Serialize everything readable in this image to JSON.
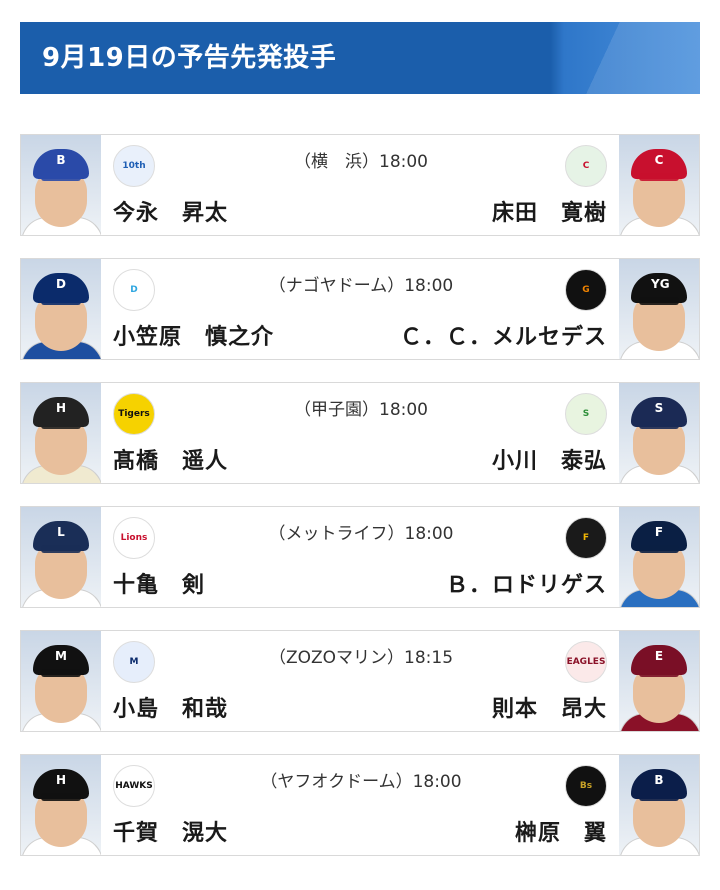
{
  "header": {
    "title": "9月19日の予告先発投手"
  },
  "games": [
    {
      "venue_time": "（横　浜）18:00",
      "home": {
        "pitcher": "今永　昇太",
        "logo_icon": "baystars-logo-icon",
        "logo_text": "10th",
        "cap_mark": "B",
        "cap_color": "#2a4aa8",
        "logo_bg": "#e9f0fb",
        "logo_fg": "#1f5fb5",
        "uniform_color": "#ffffff"
      },
      "away": {
        "pitcher": "床田　寛樹",
        "logo_icon": "carp-logo-icon",
        "logo_text": "C",
        "cap_mark": "C",
        "cap_color": "#c8102e",
        "logo_bg": "#e6f3e6",
        "logo_fg": "#c8102e",
        "uniform_color": "#ffffff"
      }
    },
    {
      "venue_time": "（ナゴヤドーム）18:00",
      "home": {
        "pitcher": "小笠原　慎之介",
        "logo_icon": "dragons-logo-icon",
        "logo_text": "D",
        "cap_mark": "D",
        "cap_color": "#0b2b6b",
        "logo_bg": "#ffffff",
        "logo_fg": "#2ea6e0",
        "uniform_color": "#1e4fa0"
      },
      "away": {
        "pitcher": "Ｃ．Ｃ．メルセデス",
        "logo_icon": "giants-logo-icon",
        "logo_text": "G",
        "cap_mark": "YG",
        "cap_color": "#111111",
        "logo_bg": "#111111",
        "logo_fg": "#f08300",
        "uniform_color": "#ffffff"
      }
    },
    {
      "venue_time": "（甲子園）18:00",
      "home": {
        "pitcher": "髙橋　遥人",
        "logo_icon": "tigers-logo-icon",
        "logo_text": "Tigers",
        "cap_mark": "H",
        "cap_color": "#222222",
        "logo_bg": "#f6d200",
        "logo_fg": "#111111",
        "uniform_color": "#f0ead0"
      },
      "away": {
        "pitcher": "小川　泰弘",
        "logo_icon": "swallows-logo-icon",
        "logo_text": "S",
        "cap_mark": "S",
        "cap_color": "#1b2a55",
        "logo_bg": "#e8f4e0",
        "logo_fg": "#2f8f3a",
        "uniform_color": "#ffffff"
      }
    },
    {
      "venue_time": "（メットライフ）18:00",
      "home": {
        "pitcher": "十亀　剣",
        "logo_icon": "lions-logo-icon",
        "logo_text": "Lions",
        "cap_mark": "L",
        "cap_color": "#1a2e57",
        "logo_bg": "#ffffff",
        "logo_fg": "#c8102e",
        "uniform_color": "#ffffff"
      },
      "away": {
        "pitcher": "Ｂ．ロドリゲス",
        "logo_icon": "fighters-logo-icon",
        "logo_text": "F",
        "cap_mark": "F",
        "cap_color": "#0a1f44",
        "logo_bg": "#1a1a1a",
        "logo_fg": "#f2b705",
        "uniform_color": "#2a6fc0"
      }
    },
    {
      "venue_time": "（ZOZOマリン）18:15",
      "home": {
        "pitcher": "小島　和哉",
        "logo_icon": "marines-logo-icon",
        "logo_text": "M",
        "cap_mark": "M",
        "cap_color": "#111111",
        "logo_bg": "#e6eefb",
        "logo_fg": "#0a2a6b",
        "uniform_color": "#ffffff"
      },
      "away": {
        "pitcher": "則本　昂大",
        "logo_icon": "eagles-logo-icon",
        "logo_text": "EAGLES",
        "cap_mark": "E",
        "cap_color": "#7a0f26",
        "logo_bg": "#fbe9e9",
        "logo_fg": "#8a1128",
        "uniform_color": "#8a1128"
      }
    },
    {
      "venue_time": "（ヤフオクドーム）18:00",
      "home": {
        "pitcher": "千賀　滉大",
        "logo_icon": "hawks-logo-icon",
        "logo_text": "HAWKS",
        "cap_mark": "H",
        "cap_color": "#111111",
        "logo_bg": "#ffffff",
        "logo_fg": "#111111",
        "uniform_color": "#ffffff"
      },
      "away": {
        "pitcher": "榊原　翼",
        "logo_icon": "buffaloes-logo-icon",
        "logo_text": "Bs",
        "cap_mark": "B",
        "cap_color": "#0b1e4a",
        "logo_bg": "#111111",
        "logo_fg": "#c9a227",
        "uniform_color": "#ffffff"
      }
    }
  ]
}
